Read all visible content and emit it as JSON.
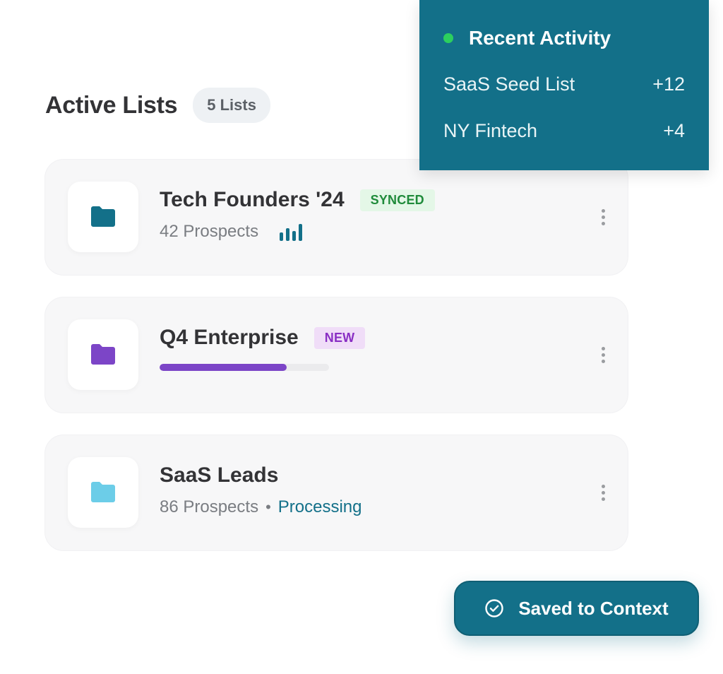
{
  "header": {
    "title": "Active Lists",
    "count_badge": "5 Lists"
  },
  "lists": [
    {
      "title": "Tech Founders '24",
      "tag": "SYNCED",
      "meta": "42 Prospects",
      "folder_color": "#137089",
      "icon": "bar-chart-icon"
    },
    {
      "title": "Q4 Enterprise",
      "tag": "NEW",
      "folder_color": "#7c45c7",
      "progress": 0.75
    },
    {
      "title": "SaaS Leads",
      "meta": "86 Prospects",
      "separator": "•",
      "status": "Processing",
      "folder_color": "#6ccde8"
    }
  ],
  "activity": {
    "title": "Recent Activity",
    "items": [
      {
        "name": "SaaS Seed List",
        "delta": "+12"
      },
      {
        "name": "NY Fintech",
        "delta": "+4"
      }
    ]
  },
  "saved_button": {
    "label": "Saved to Context",
    "icon": "check-circle-icon"
  },
  "colors": {
    "accent": "#137089",
    "live": "#2ccf5e",
    "synced_text": "#1f8b3a",
    "new_text": "#8a2fc4"
  }
}
